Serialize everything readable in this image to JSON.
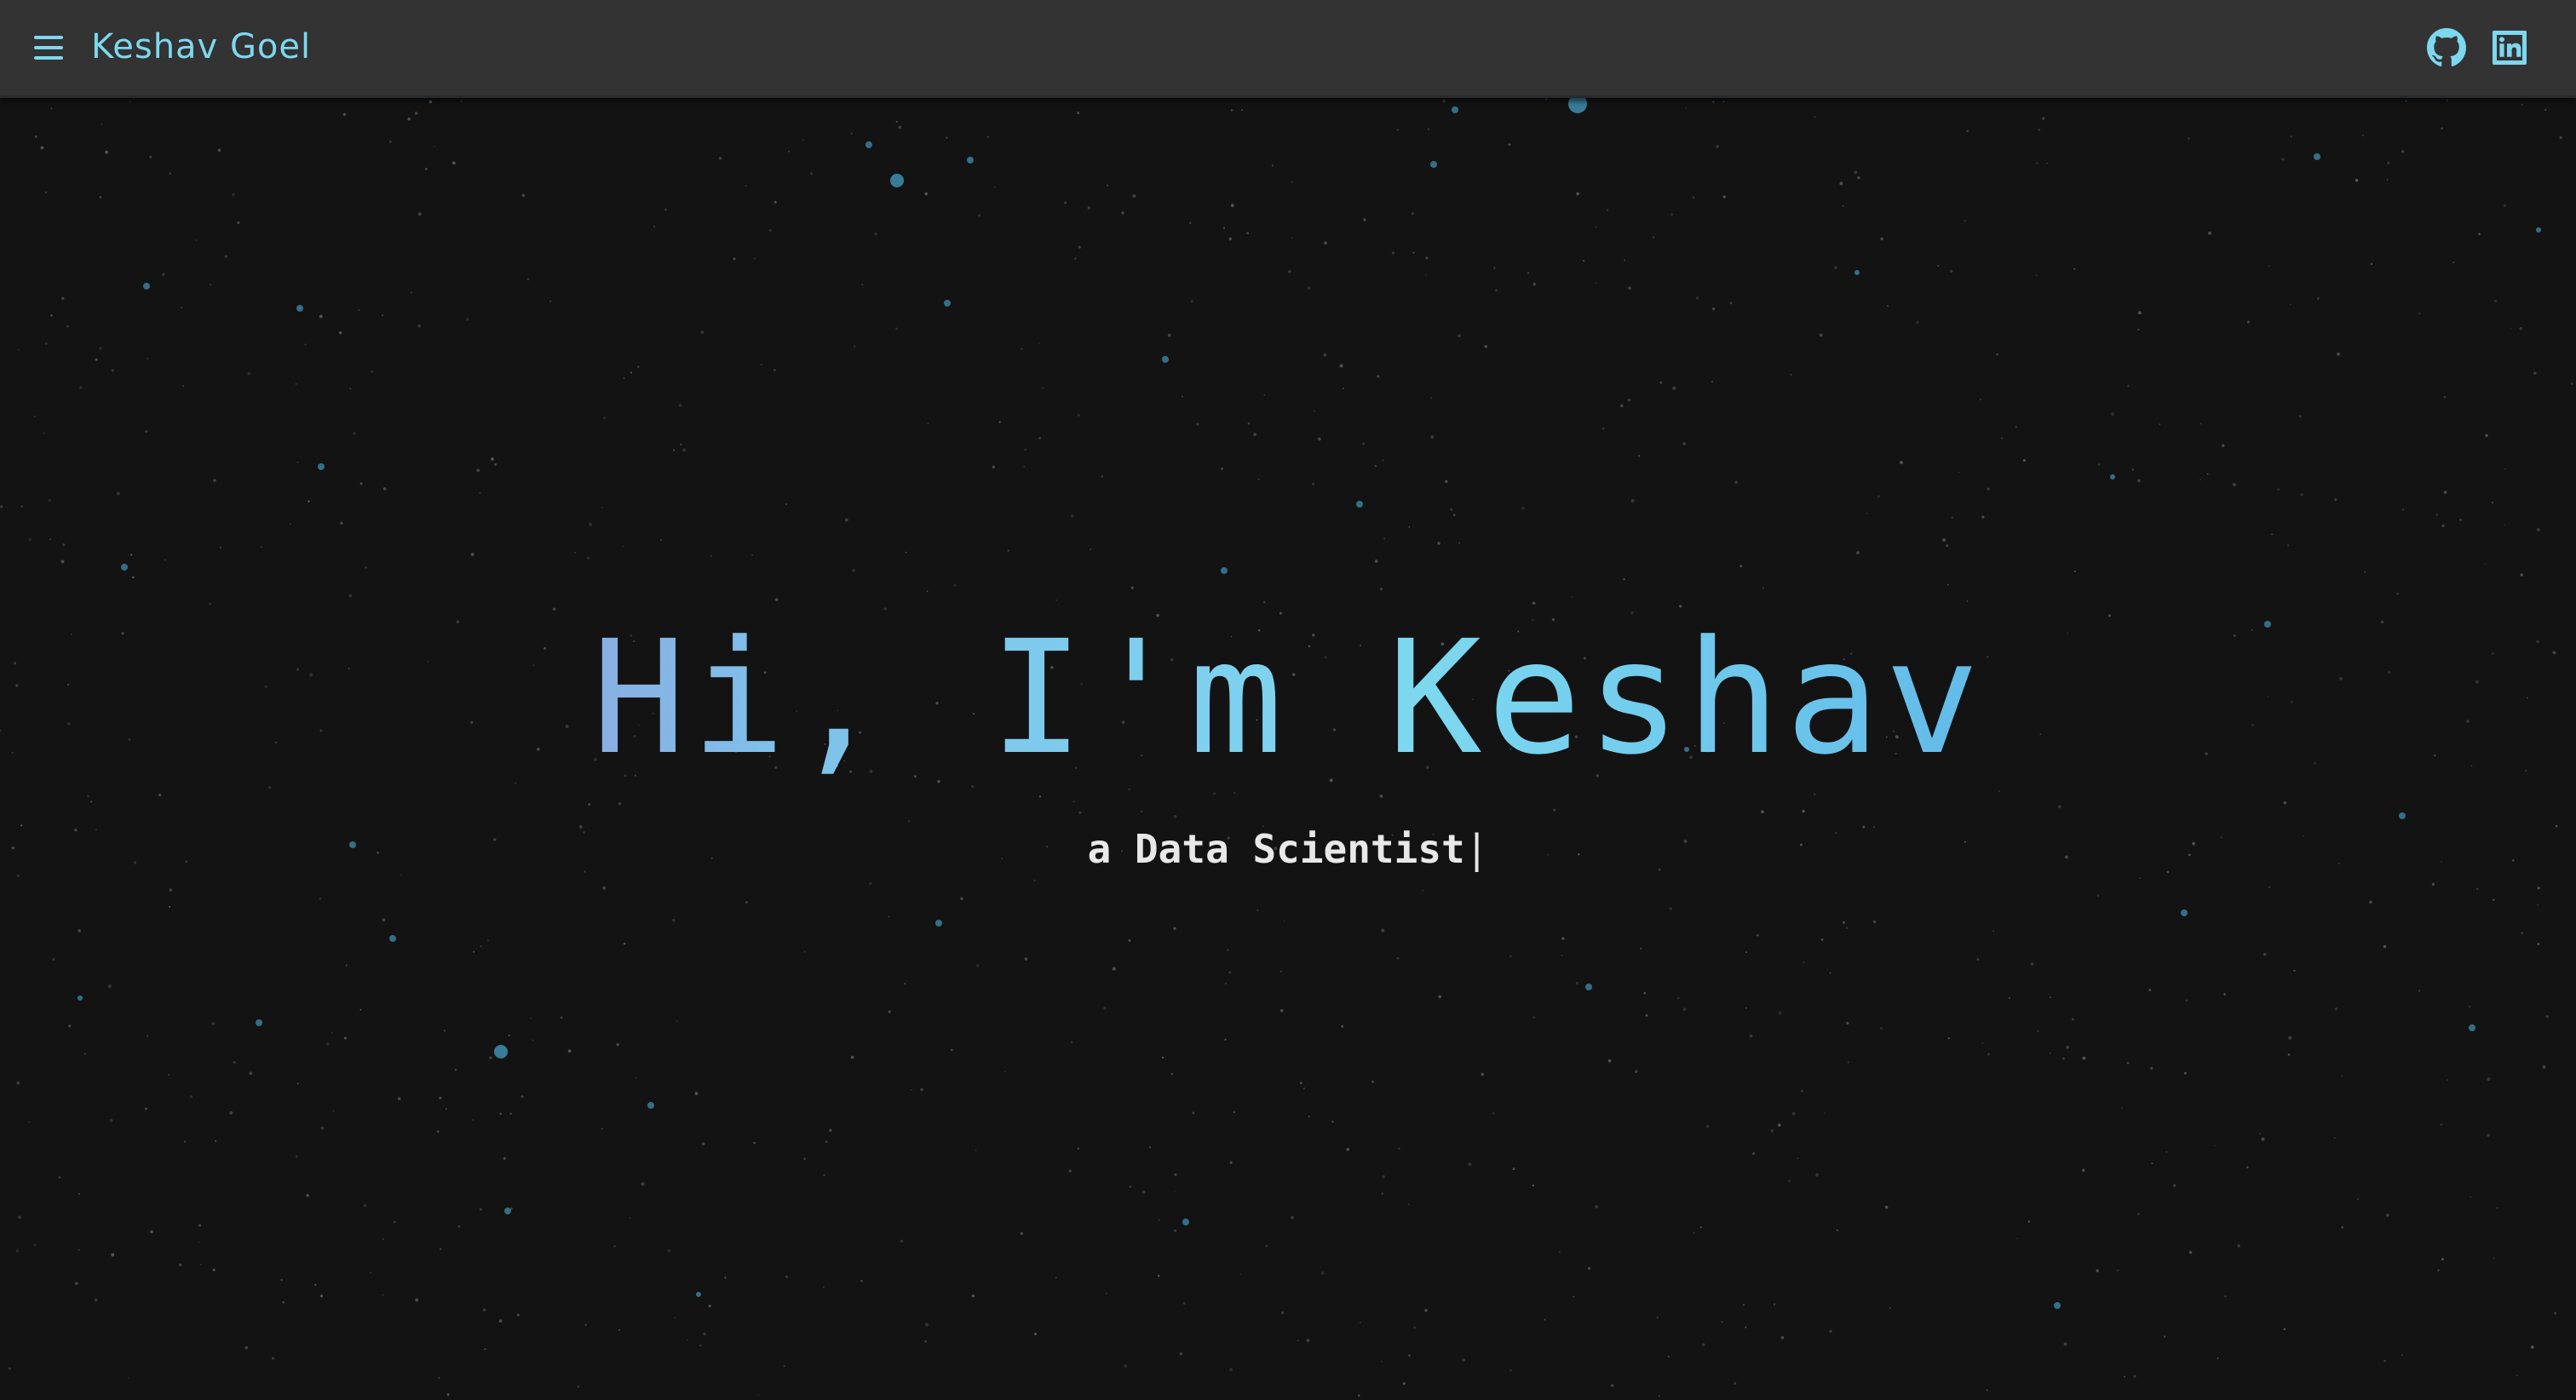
{
  "navbar": {
    "brand": "Keshav Goel",
    "menu_icon": "hamburger-menu-icon",
    "links": [
      {
        "icon": "github-icon"
      },
      {
        "icon": "linkedin-icon"
      }
    ]
  },
  "hero": {
    "greeting": "Hi, I'm Keshav",
    "subtitle": "a Data Scientist",
    "cursor": "|"
  },
  "colors": {
    "background": "#131314",
    "navbar": "#333334",
    "accent": "#7dd8ef",
    "gradient_start": "#8f5fbd",
    "gradient_end": "#4c9ed9",
    "subtitle": "#e8e8e8",
    "star": "#3f8fb0"
  }
}
